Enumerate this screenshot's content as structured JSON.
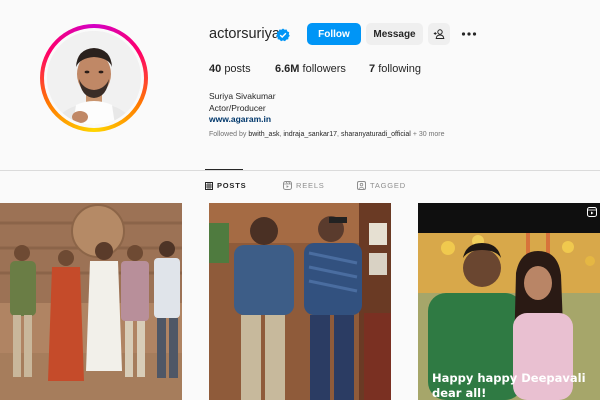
{
  "profile": {
    "username": "actorsuriya",
    "verified": true,
    "follow_label": "Follow",
    "message_label": "Message",
    "posts_count": "40",
    "posts_label": "posts",
    "followers_count": "6.6M",
    "followers_label": "followers",
    "following_count": "7",
    "following_label": "following",
    "full_name": "Suriya Sivakumar",
    "category": "Actor/Producer",
    "website": "www.agaram.in",
    "followed_by_prefix": "Followed by",
    "followed_by_users": [
      "bwith_ask",
      "indraja_sankar17",
      "sharanyaturadi_official"
    ],
    "followed_by_suffix": "+ 30 more"
  },
  "tabs": [
    {
      "label": "POSTS",
      "icon": "grid-icon",
      "active": true
    },
    {
      "label": "REELS",
      "icon": "reels-icon",
      "active": false
    },
    {
      "label": "TAGGED",
      "icon": "tagged-icon",
      "active": false
    }
  ],
  "posts": [
    {
      "type": "photo",
      "description_icon": "group-photo"
    },
    {
      "type": "photo",
      "description_icon": "two-men-photo"
    },
    {
      "type": "reel",
      "caption_line1": "Happy happy Deepavali",
      "caption_line2": "dear all!"
    }
  ],
  "colors": {
    "accent": "#0095f6",
    "verified_badge": "#0095f6",
    "link": "#00376b",
    "muted": "#737373"
  }
}
